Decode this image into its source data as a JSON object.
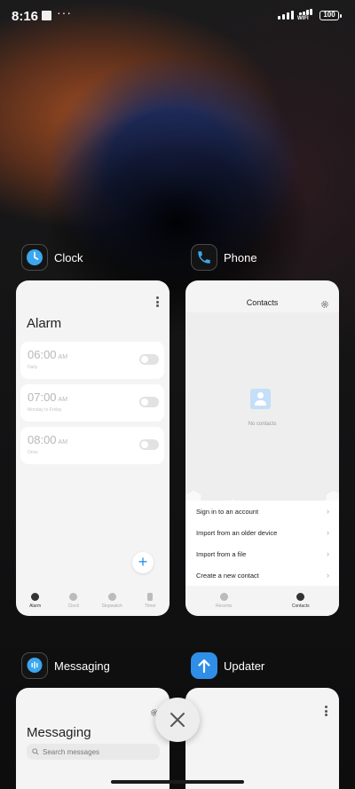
{
  "status_bar": {
    "time": "8:16",
    "more": "···",
    "wifi_label": "WIFI",
    "battery": "100"
  },
  "clock": {
    "app_name": "Clock",
    "title": "Alarm",
    "alarms": [
      {
        "time": "06:00",
        "period": "AM",
        "subtitle": "Daily"
      },
      {
        "time": "07:00",
        "period": "AM",
        "subtitle": "Monday to Friday"
      },
      {
        "time": "08:00",
        "period": "AM",
        "subtitle": "Once"
      }
    ],
    "add_label": "+",
    "tabs": [
      "Alarm",
      "Clock",
      "Stopwatch",
      "Timer"
    ]
  },
  "phone": {
    "app_name": "Phone",
    "title": "Contacts",
    "empty_text": "No contacts",
    "options": [
      "Sign in to an account",
      "Import from an older device",
      "Import from a file",
      "Create a new contact"
    ],
    "chevron": "›",
    "tabs": [
      "Recents",
      "Contacts"
    ]
  },
  "messaging": {
    "app_name": "Messaging",
    "title": "Messaging",
    "search_placeholder": "Search messages"
  },
  "updater": {
    "app_name": "Updater"
  },
  "colors": {
    "accent": "#2f8ee8",
    "card": "#f4f4f4",
    "background": "#141415"
  },
  "icons": [
    "clock-icon",
    "phone-icon",
    "message-icon",
    "arrow-up-icon",
    "gear-icon",
    "close-icon",
    "search-icon"
  ]
}
